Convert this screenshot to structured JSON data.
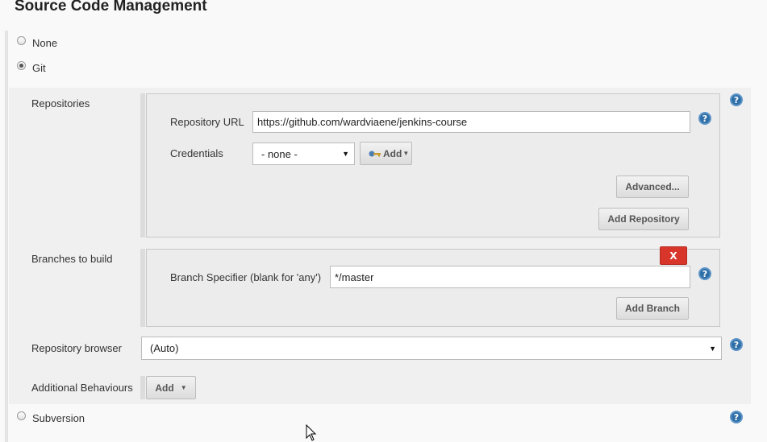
{
  "header": {
    "title": "Source Code Management"
  },
  "scm": {
    "none_label": "None",
    "git_label": "Git",
    "subversion_label": "Subversion",
    "selected": "Git"
  },
  "git": {
    "repositories_label": "Repositories",
    "repo_url_label": "Repository URL",
    "repo_url_value": "https://github.com/wardviaene/jenkins-course",
    "credentials_label": "Credentials",
    "credentials_value": "- none -",
    "add_credentials_label": "Add",
    "advanced_label": "Advanced...",
    "add_repository_label": "Add Repository",
    "branches_label": "Branches to build",
    "delete_label": "X",
    "branch_specifier_label": "Branch Specifier (blank for 'any')",
    "branch_specifier_value": "*/master",
    "add_branch_label": "Add Branch",
    "repo_browser_label": "Repository browser",
    "repo_browser_value": "(Auto)",
    "additional_behaviours_label": "Additional Behaviours",
    "add_behaviour_label": "Add"
  },
  "icons": {
    "help": "help-icon",
    "key": "key-icon",
    "cursor": "mouse-cursor-icon"
  },
  "colors": {
    "help_blue": "#2f6fa7",
    "delete_red": "#d9362b"
  }
}
